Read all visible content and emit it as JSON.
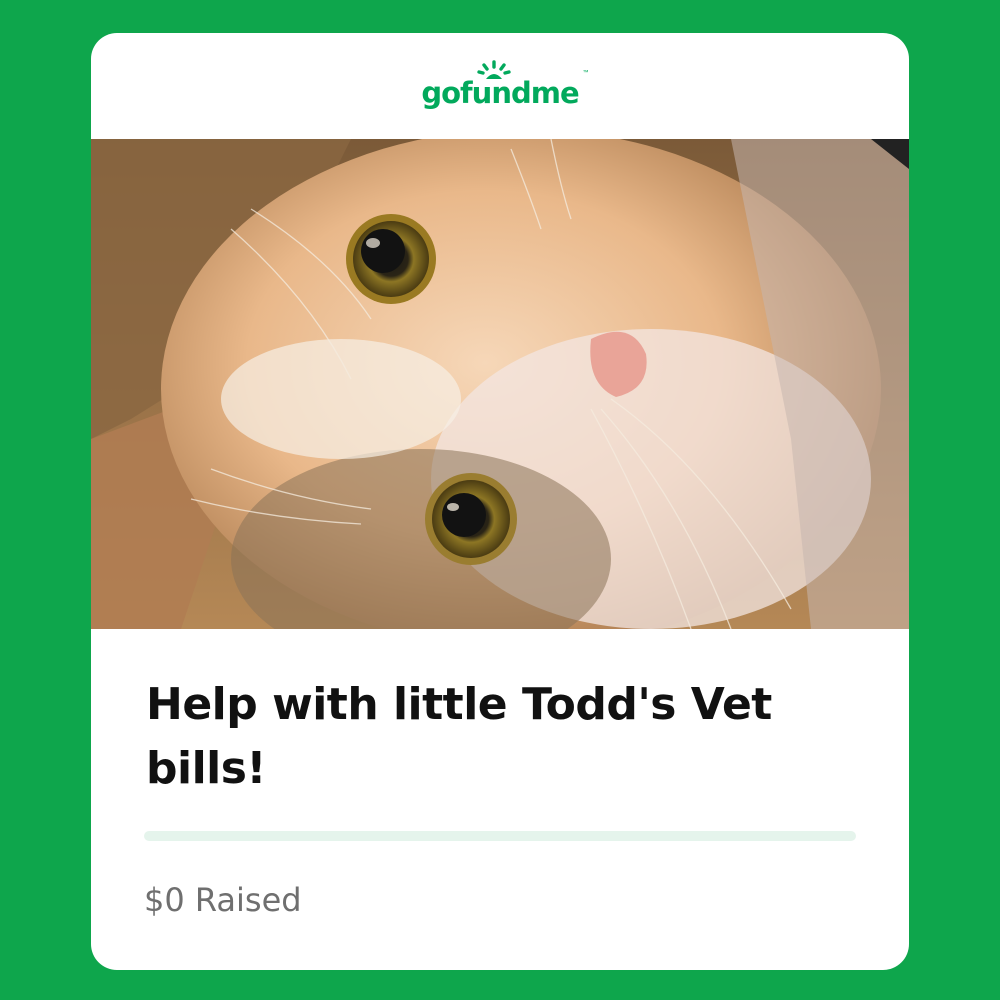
{
  "brand": {
    "logo_text": "gofundme",
    "trademark": "™",
    "color": "#02a95c"
  },
  "campaign": {
    "photo_subject": "kitten",
    "title": "Help with little Todd's Vet bills!",
    "raised_text": "$0 Raised",
    "progress_fraction": 0
  },
  "colors": {
    "background": "#0ea64c",
    "card": "#ffffff",
    "progress_track": "#e5f4ec"
  }
}
